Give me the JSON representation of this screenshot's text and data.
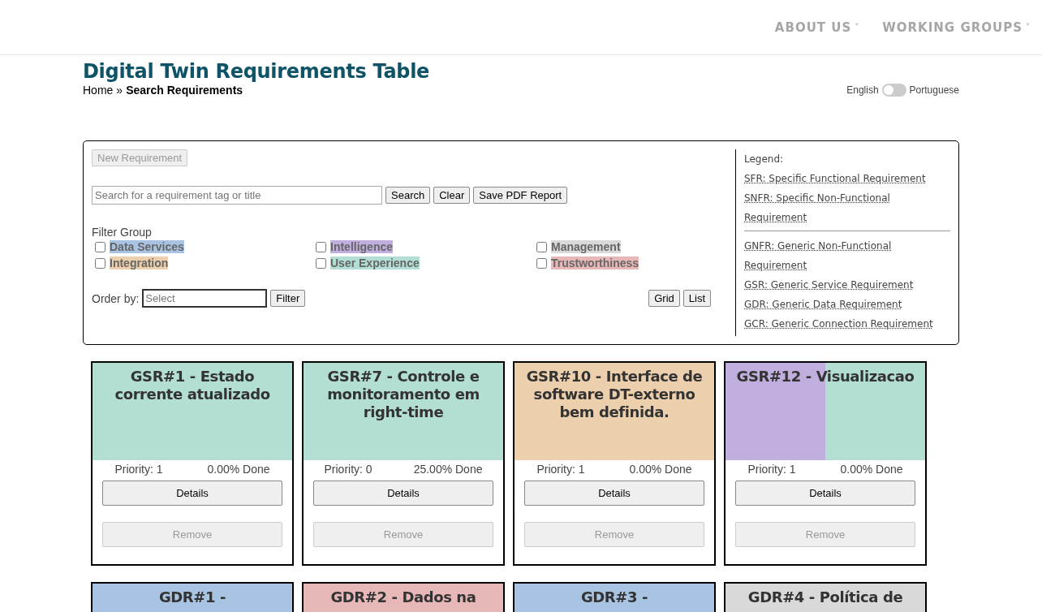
{
  "nav": [
    {
      "label": "ABOUT US",
      "caret": "˅"
    },
    {
      "label": "WORKING GROUPS",
      "caret": "˅"
    }
  ],
  "page_title": "Digital Twin Requirements Table",
  "breadcrumb": {
    "home": "Home",
    "separator": "»",
    "current": "Search Requirements"
  },
  "language_toggle": {
    "left": "English",
    "right": "Portuguese",
    "on": false
  },
  "filter_panel": {
    "new_button": {
      "label": "New Requirement",
      "disabled": true
    },
    "search": {
      "placeholder": "Search for a requirement tag or title"
    },
    "buttons": [
      "Search",
      "Clear",
      "Save PDF Report"
    ],
    "filter_group_label": "Filter Group",
    "groups": [
      {
        "label": "Data Services",
        "color": "#a9c4e3",
        "checked": false
      },
      {
        "label": "Intelligence",
        "color": "#c0aede",
        "checked": false
      },
      {
        "label": "Management",
        "color": "#d9d9d9",
        "checked": false
      },
      {
        "label": "Integration",
        "color": "#eccfac",
        "checked": false
      },
      {
        "label": "User Experience",
        "color": "#b3ded4",
        "checked": false
      },
      {
        "label": "Trustworthiness",
        "color": "#e8b8b8",
        "checked": false
      }
    ],
    "order_by": {
      "label": "Order by:",
      "placeholder": "Select",
      "button": "Filter"
    },
    "view_buttons": [
      "Grid",
      "List"
    ],
    "legend": {
      "title": "Legend:",
      "specific": [
        "SFR: Specific Functional Requirement",
        "SNFR: Specific Non-Functional Requirement"
      ],
      "generic": [
        "GNFR: Generic Non-Functional Requirement",
        "GSR: Generic Service Requirement",
        "GDR: Generic Data Requirement",
        "GCR: Generic Connection Requirement"
      ]
    }
  },
  "cards": [
    {
      "title": "GSR#1 - Estado corrente atualizado",
      "bands": [
        {
          "color": "#b3ded4"
        }
      ],
      "priority": "Priority: 1",
      "done": "0.00% Done",
      "details": "Details",
      "remove": {
        "label": "Remove",
        "disabled": true
      }
    },
    {
      "title": "GSR#7 - Controle e monitoramento em right-time",
      "bands": [
        {
          "color": "#b3ded4"
        }
      ],
      "priority": "Priority: 0",
      "done": "25.00% Done",
      "details": "Details",
      "remove": {
        "label": "Remove",
        "disabled": true
      }
    },
    {
      "title": "GSR#10 - Interface de software DT-externo bem definida.",
      "bands": [
        {
          "color": "#eccfac"
        }
      ],
      "priority": "Priority: 1",
      "done": "0.00% Done",
      "details": "Details",
      "remove": {
        "label": "Remove",
        "disabled": true
      }
    },
    {
      "title": "GSR#12 - Visualizacao",
      "bands": [
        {
          "color": "#c0aede"
        },
        {
          "color": "#b3ded4"
        }
      ],
      "priority": "Priority: 1",
      "done": "0.00% Done",
      "details": "Details",
      "remove": {
        "label": "Remove",
        "disabled": true
      }
    },
    {
      "title": "GDR#1 -",
      "bands": [
        {
          "color": "#a9c4e3"
        }
      ]
    },
    {
      "title": "GDR#2 - Dados na",
      "bands": [
        {
          "color": "#e8b8b8"
        }
      ]
    },
    {
      "title": "GDR#3 -",
      "bands": [
        {
          "color": "#a9c4e3"
        }
      ]
    },
    {
      "title": "GDR#4 - Política de",
      "bands": [
        {
          "color": "#d9d9d9"
        }
      ]
    }
  ]
}
